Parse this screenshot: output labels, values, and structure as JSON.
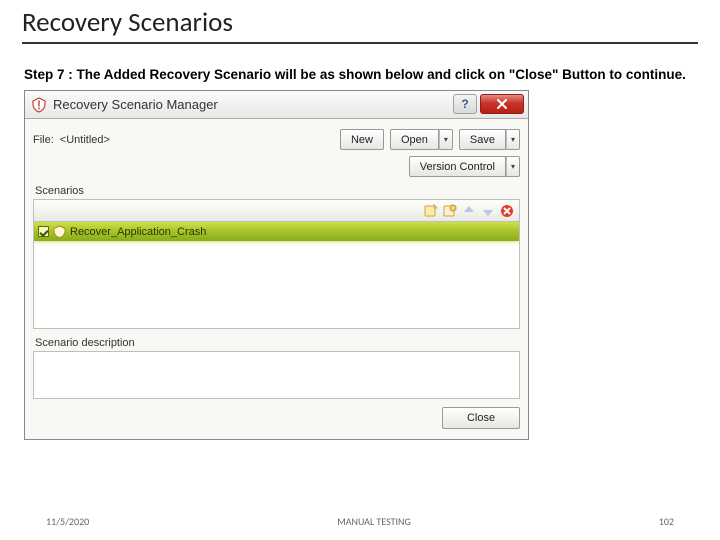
{
  "page": {
    "title": "Recovery Scenarios",
    "step_text": "Step 7 : The Added Recovery Scenario will be as shown below and click on \"Close\" Button to continue."
  },
  "dialog": {
    "title": "Recovery Scenario Manager",
    "help_glyph": "?",
    "file_label": "File:",
    "file_value": "<Untitled>",
    "buttons": {
      "new": "New",
      "open": "Open",
      "save": "Save",
      "version_control": "Version Control"
    },
    "scenarios_label": "Scenarios",
    "selected_scenario": "Recover_Application_Crash",
    "description_label": "Scenario description",
    "close": "Close"
  },
  "footer": {
    "date": "11/5/2020",
    "center": "MANUAL TESTING",
    "page_no": "102"
  }
}
